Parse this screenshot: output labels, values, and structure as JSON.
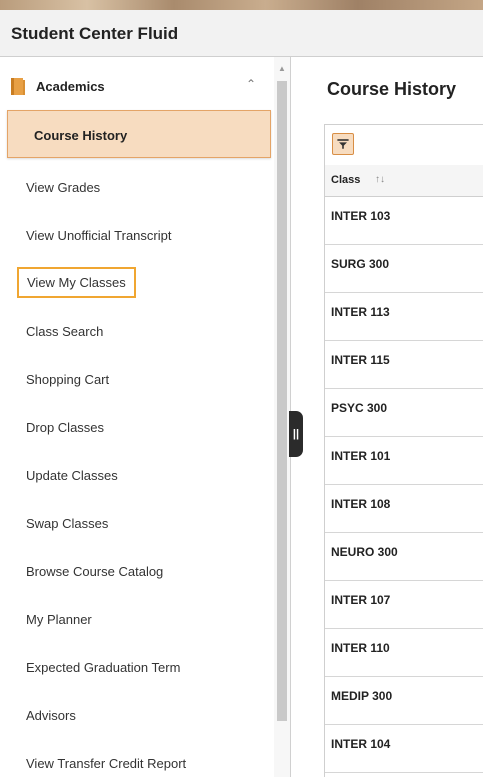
{
  "app": {
    "title": "Student Center Fluid"
  },
  "sidebar": {
    "section": {
      "label": "Academics",
      "icon": "book-icon",
      "collapse_icon": "chevron-up-icon"
    },
    "items": [
      {
        "label": "Course History",
        "state": "selected"
      },
      {
        "label": "View Grades"
      },
      {
        "label": "View Unofficial Transcript"
      },
      {
        "label": "View My Classes",
        "state": "focused"
      },
      {
        "label": "Class Search"
      },
      {
        "label": "Shopping Cart"
      },
      {
        "label": "Drop Classes"
      },
      {
        "label": "Update Classes"
      },
      {
        "label": "Swap Classes"
      },
      {
        "label": "Browse Course Catalog"
      },
      {
        "label": "My Planner"
      },
      {
        "label": "Expected Graduation Term"
      },
      {
        "label": "Advisors"
      },
      {
        "label": "View Transfer Credit Report"
      }
    ]
  },
  "splitter": {
    "glyph": "||"
  },
  "main": {
    "title": "Course History",
    "filter_icon": "filter-icon",
    "table": {
      "column_header": "Class",
      "sort_glyph": "↑↓",
      "rows": [
        "INTER 103",
        "SURG 300",
        "INTER 113",
        "INTER 115",
        "PSYC 300",
        "INTER 101",
        "INTER 108",
        "NEURO 300",
        "INTER 107",
        "INTER 110",
        "MEDIP 300",
        "INTER 104"
      ]
    }
  },
  "colors": {
    "selected_bg": "#f7dcc0",
    "selected_border": "#e4a467",
    "focus_outline": "#f0a631",
    "header_bg": "#f2f2f2",
    "book_icon": "#e8a045"
  }
}
